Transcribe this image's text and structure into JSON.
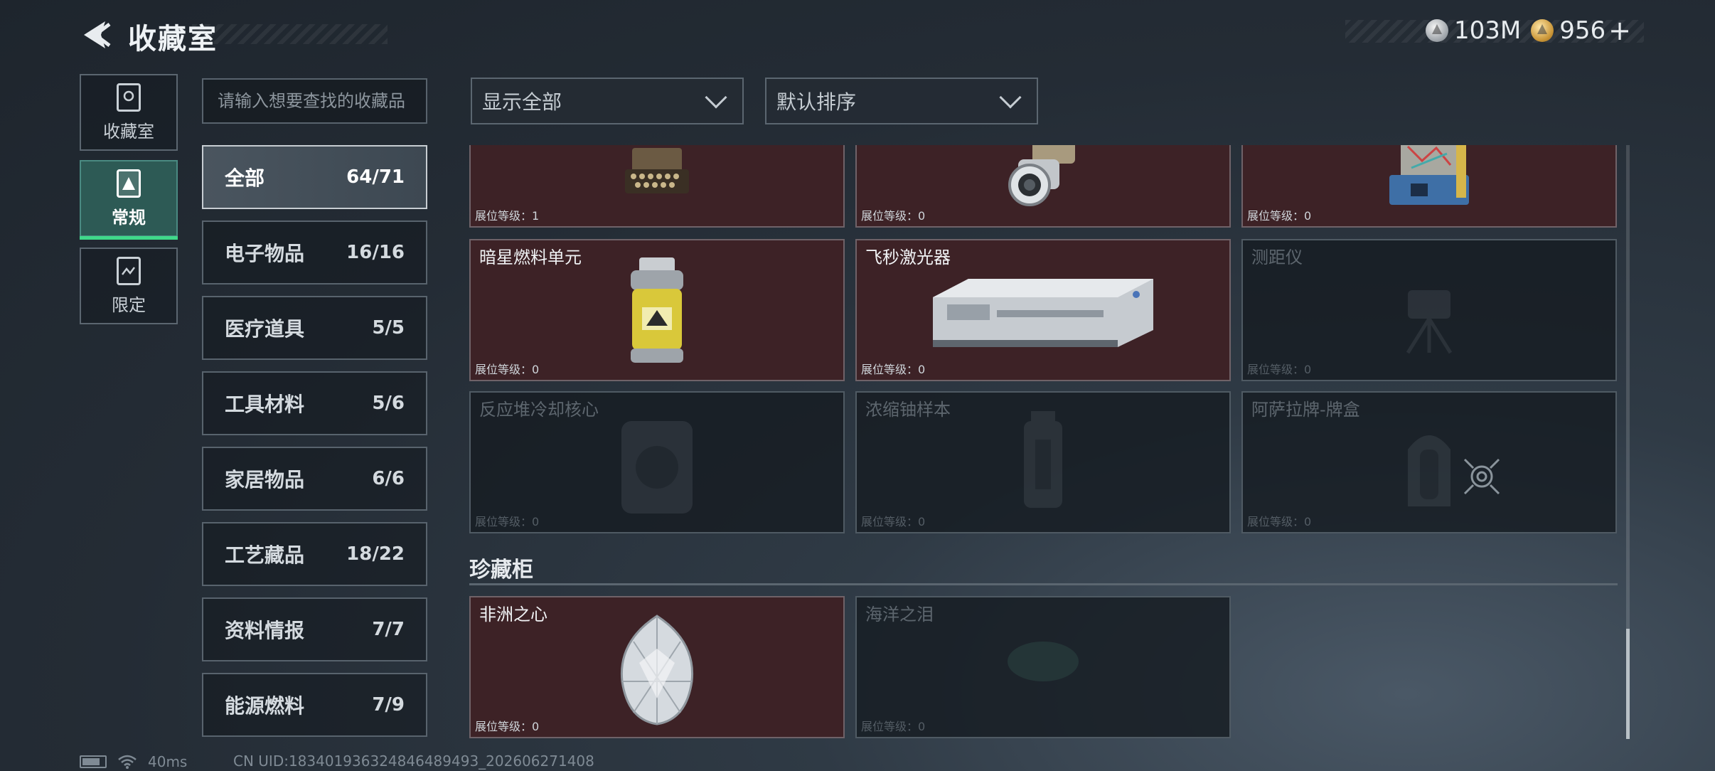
{
  "header": {
    "title": "收藏室",
    "currency": [
      {
        "icon": "silver-coin-icon",
        "value": "103M"
      },
      {
        "icon": "gold-coin-icon",
        "value": "956"
      }
    ],
    "add_label": "+"
  },
  "leftnav": [
    {
      "label": "收藏室",
      "icon": "collection-room-icon"
    },
    {
      "label": "常规",
      "icon": "regular-icon",
      "active": true
    },
    {
      "label": "限定",
      "icon": "limited-icon"
    }
  ],
  "search": {
    "placeholder": "请输入想要查找的收藏品"
  },
  "filters": {
    "display": "显示全部",
    "sort": "默认排序"
  },
  "categories": [
    {
      "name": "全部",
      "count": "64/71",
      "active": true
    },
    {
      "name": "电子物品",
      "count": "16/16"
    },
    {
      "name": "医疗道具",
      "count": "5/5"
    },
    {
      "name": "工具材料",
      "count": "5/6"
    },
    {
      "name": "家居物品",
      "count": "6/6"
    },
    {
      "name": "工艺藏品",
      "count": "18/22"
    },
    {
      "name": "资料情报",
      "count": "7/7"
    },
    {
      "name": "能源燃料",
      "count": "7/9"
    }
  ],
  "items": [
    {
      "name": "",
      "level": "展位等级：1",
      "unlocked": true,
      "icon": "typewriter-icon"
    },
    {
      "name": "",
      "level": "展位等级：0",
      "unlocked": true,
      "icon": "lens-icon"
    },
    {
      "name": "",
      "level": "展位等级：0",
      "unlocked": true,
      "icon": "device-icon"
    },
    {
      "name": "暗星燃料单元",
      "level": "展位等级：0",
      "unlocked": true,
      "icon": "fuel-canister-icon"
    },
    {
      "name": "飞秒激光器",
      "level": "展位等级：0",
      "unlocked": true,
      "icon": "laser-icon"
    },
    {
      "name": "测距仪",
      "level": "展位等级：0",
      "unlocked": false,
      "icon": "rangefinder-icon"
    },
    {
      "name": "反应堆冷却核心",
      "level": "展位等级：0",
      "unlocked": false,
      "icon": "reactor-core-icon"
    },
    {
      "name": "浓缩铀样本",
      "level": "展位等级：0",
      "unlocked": false,
      "icon": "uranium-sample-icon"
    },
    {
      "name": "阿萨拉牌-牌盒",
      "level": "展位等级：0",
      "unlocked": false,
      "icon": "card-box-icon"
    }
  ],
  "treasure": {
    "title": "珍藏柜",
    "items": [
      {
        "name": "非洲之心",
        "level": "展位等级：0",
        "unlocked": true,
        "icon": "diamond-icon"
      },
      {
        "name": "海洋之泪",
        "level": "展位等级：0",
        "unlocked": false,
        "icon": "ocean-gem-icon"
      }
    ]
  },
  "status": {
    "ping": "40ms",
    "uid": "CN UID:183401936324846489493_202606271408"
  },
  "colors": {
    "accent": "#3fd88a",
    "unlocked_card": "#3d2226",
    "active_nav": "#2d5a55"
  }
}
